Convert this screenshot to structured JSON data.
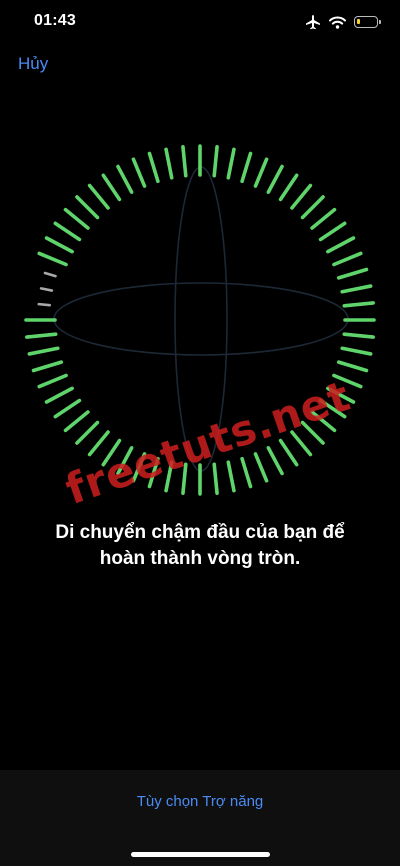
{
  "status": {
    "time": "01:43",
    "icons": [
      "airplane-icon",
      "wifi-icon",
      "battery-icon"
    ],
    "battery_level": 0.15,
    "battery_color": "#f7d32c"
  },
  "nav": {
    "cancel_label": "Hủy"
  },
  "scan": {
    "tick_count": 64,
    "completed_color": "#5fd46a",
    "pending_color": "#a8a8a8",
    "pending_range_deg": [
      -100,
      -60
    ]
  },
  "watermark": "freetuts.net",
  "instruction": {
    "line1": "Di chuyển chậm đầu của bạn để",
    "line2": "hoàn thành vòng tròn."
  },
  "bottom": {
    "accessibility_label": "Tùy chọn Trợ năng"
  },
  "colors": {
    "link": "#4a8bf5",
    "background": "#000000"
  }
}
